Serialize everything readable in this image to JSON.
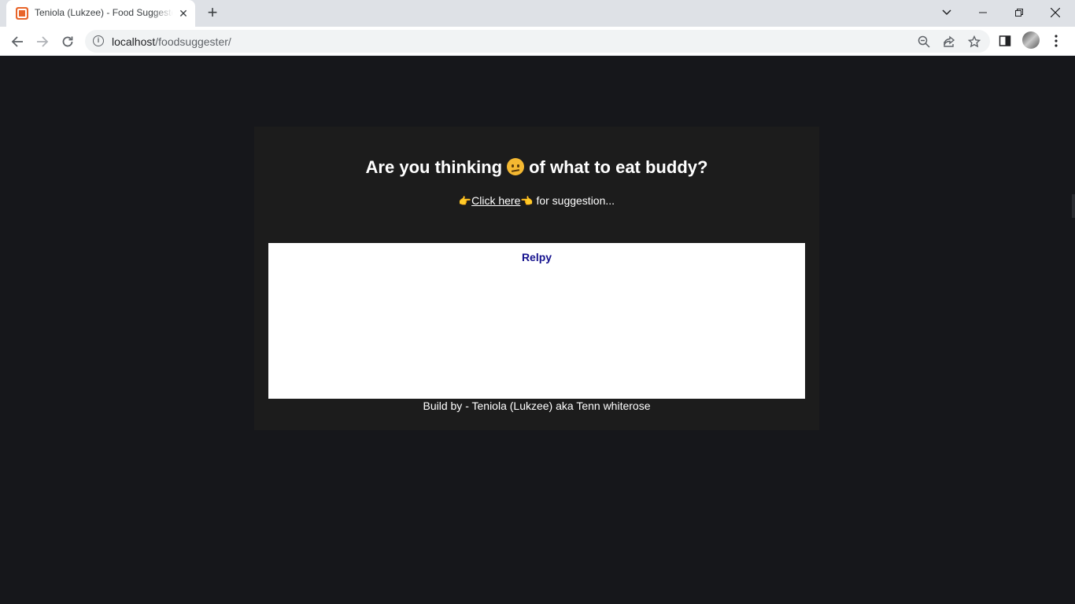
{
  "browser": {
    "tab_title": "Teniola (Lukzee) - Food Suggester",
    "tab_close": "✕",
    "new_tab": "+",
    "url_host": "localhost",
    "url_path": "/foodsuggester/",
    "favicon": "xampp-icon"
  },
  "page": {
    "heading_before": "Are you thinking",
    "heading_after": "of what to eat buddy?",
    "hand_left": "👉",
    "link_text": "Click here",
    "hand_right": "👈",
    "subline_after": "for suggestion...",
    "reply_title": "Relpy",
    "footer": "Build by - Teniola (Lukzee) aka Tenn whiterose"
  },
  "colors": {
    "page_bg": "#16171b",
    "card_bg": "#1c1c1c",
    "reply_title": "#15128e"
  }
}
